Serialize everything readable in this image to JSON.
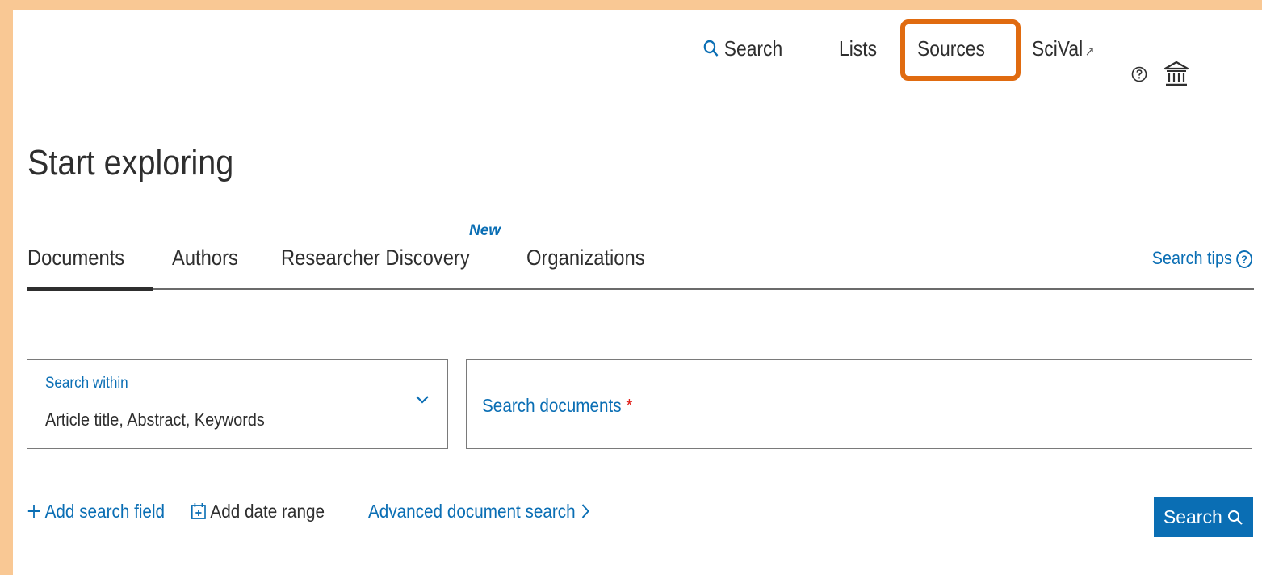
{
  "topnav": {
    "search_label": "Search",
    "lists_label": "Lists",
    "sources_label": "Sources",
    "scival_label": "SciVal",
    "scival_ext": "↗"
  },
  "page": {
    "title": "Start exploring"
  },
  "tabs": {
    "items": [
      {
        "label": "Documents"
      },
      {
        "label": "Authors"
      },
      {
        "label": "Researcher Discovery"
      },
      {
        "label": "Organizations"
      }
    ],
    "new_badge": "New",
    "search_tips": "Search tips",
    "search_tips_icon": "?"
  },
  "search": {
    "within_label": "Search within",
    "within_value": "Article title, Abstract, Keywords",
    "docs_placeholder": "Search documents",
    "required_mark": "*"
  },
  "actions": {
    "add_field": "Add search field",
    "add_date": "Add date range",
    "advanced": "Advanced document search",
    "search_button": "Search"
  },
  "colors": {
    "accent": "#0a6eb4",
    "highlight": "#e06b10",
    "required": "#e0201a",
    "background": "#f9c894"
  }
}
